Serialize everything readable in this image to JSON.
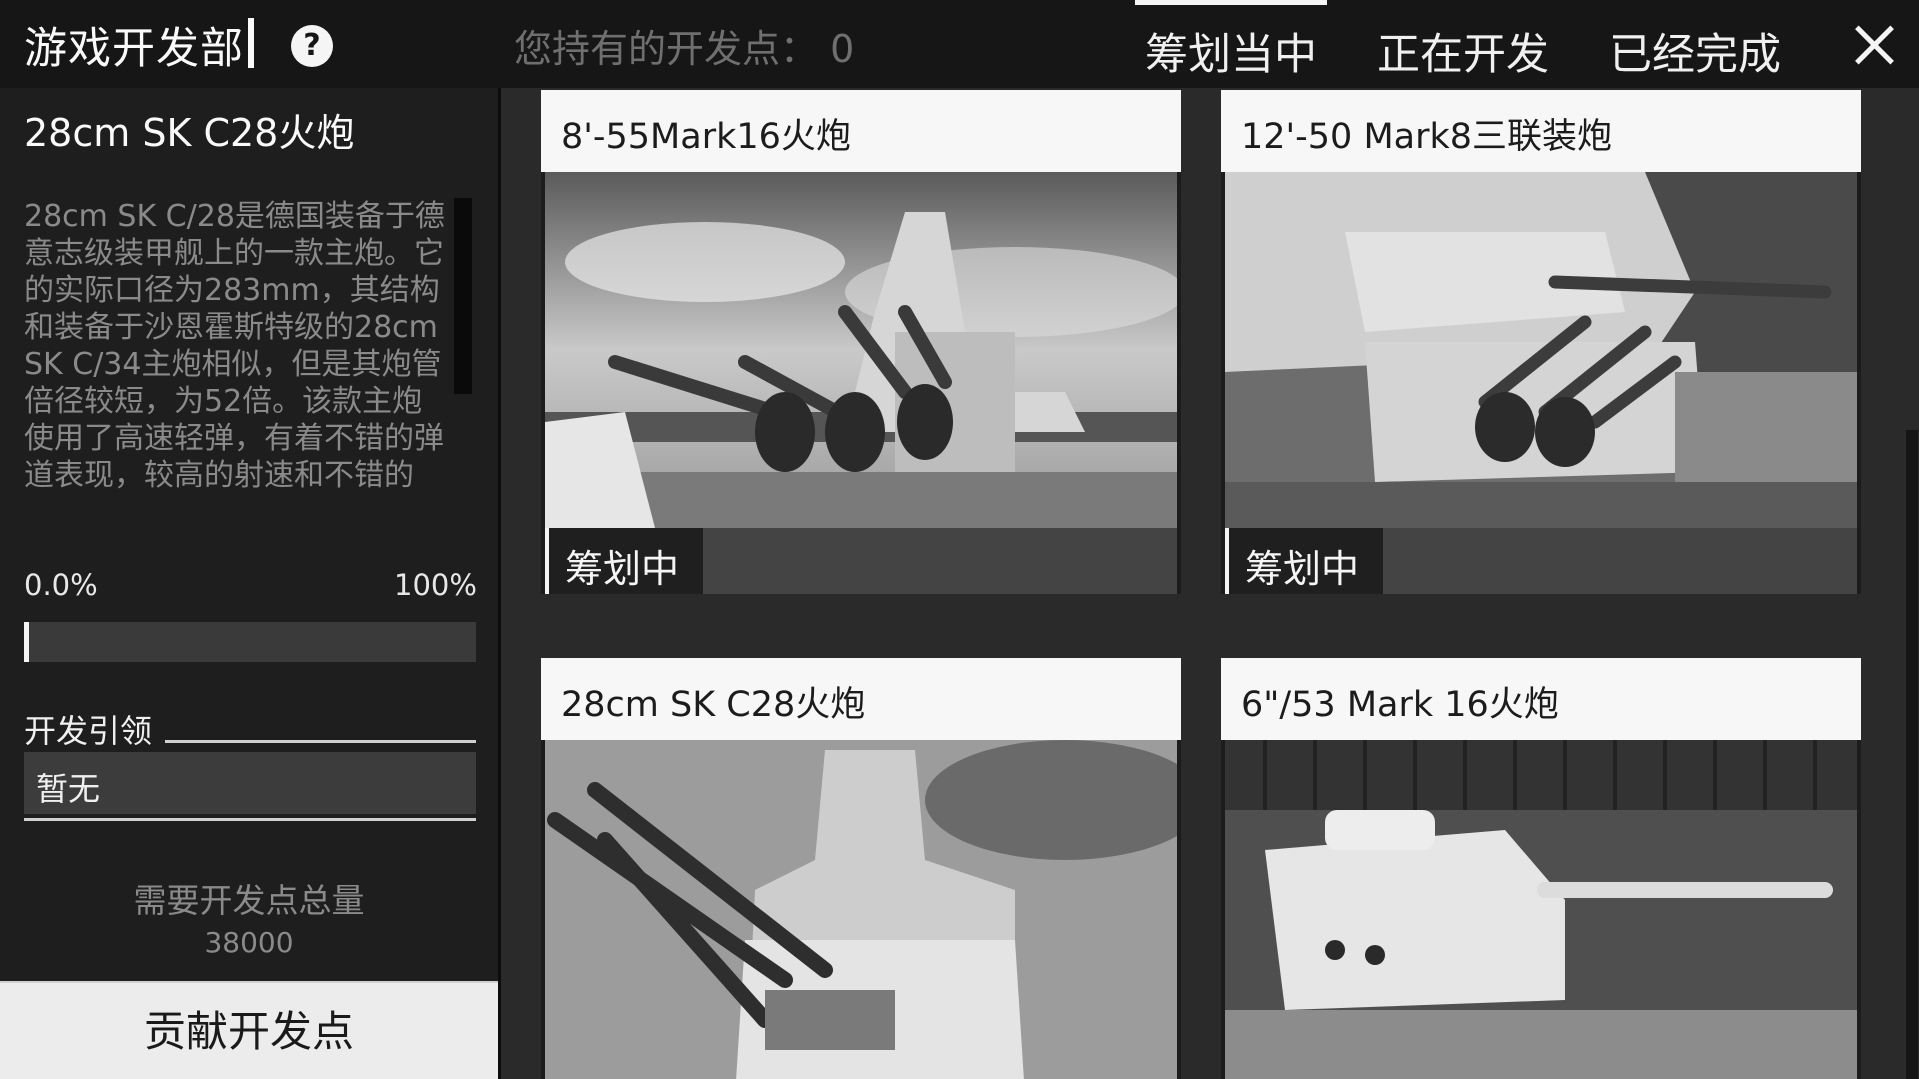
{
  "header": {
    "app_title": "游戏开发部",
    "help_icon": "question-circle-icon",
    "points_text": "您持有的开发点： 0",
    "tabs": [
      {
        "label": "筹划当中",
        "active": true
      },
      {
        "label": "正在开发",
        "active": false
      },
      {
        "label": "已经完成",
        "active": false
      }
    ],
    "close_icon": "close-icon"
  },
  "detail": {
    "title": "28cm SK C28火炮",
    "description": "28cm SK C/28是德国装备于德意志级装甲舰上的一款主炮。它的实际口径为283mm，其结构和装备于沙恩霍斯特级的28cm SK C/34主炮相似，但是其炮管倍径较短，为52倍。该款主炮使用了高速轻弹，有着不错的弹道表现，较高的射速和不错的",
    "progress": {
      "left_label": "0.0%",
      "right_label": "100%",
      "fraction": 0.0
    },
    "lead_label": "开发引领",
    "lead_value": "暂无",
    "need_label": "需要开发点总量",
    "need_value": "38000",
    "contribute_label": "贡献开发点"
  },
  "cards": [
    {
      "title": "8'-55Mark16火炮",
      "status": "筹划中"
    },
    {
      "title": "12'-50 Mark8三联装炮",
      "status": "筹划中"
    },
    {
      "title": "28cm SK C28火炮",
      "status": ""
    },
    {
      "title": "6\"/53 Mark 16火炮",
      "status": ""
    }
  ],
  "colors": {
    "background": "#1b1b1b",
    "panel": "#1e1e1e",
    "accent_light": "#f5f5f5",
    "muted_text": "#8a8a8a"
  }
}
